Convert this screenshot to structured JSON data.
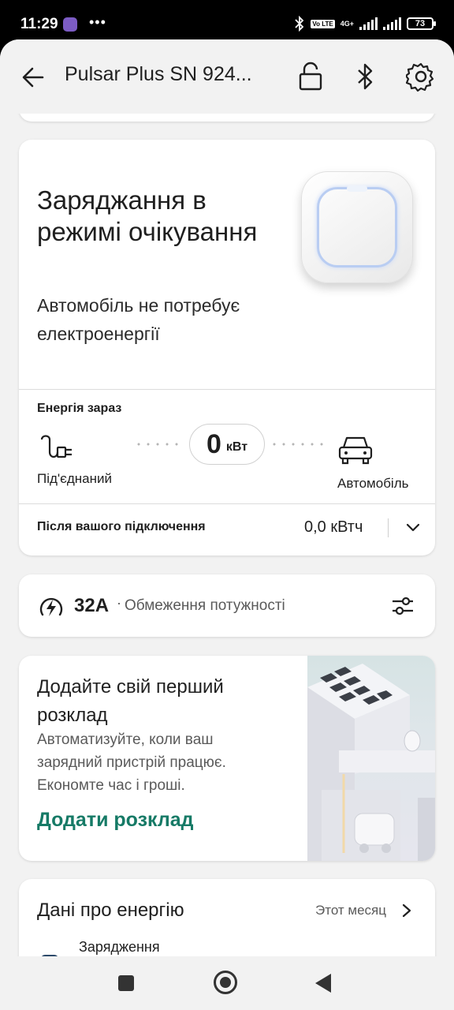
{
  "status_bar": {
    "time": "11:29",
    "dots": "•••",
    "network": "4G+",
    "volte": "Vo LTE",
    "battery": "73"
  },
  "app_bar": {
    "title": "Pulsar Plus SN 924..."
  },
  "status_card": {
    "title": "Заряджання в режимі очікування",
    "subtitle": "Автомобіль не потребує електроенергії",
    "energy_label": "Енергія зараз",
    "source_label": "Під'єднаний",
    "power_value": "0",
    "power_unit": "кВт",
    "target_label": "Автомобіль",
    "session_label": "Після вашого підключення",
    "session_value": "0,0 кВтч"
  },
  "limit_card": {
    "value": "32A",
    "separator": "·",
    "label": "Обмеження потужності"
  },
  "schedule_card": {
    "title": "Додайте свій перший розклад",
    "description": "Автоматизуйте, коли ваш зарядний пристрій працює. Економте час і гроші.",
    "link": "Додати розклад"
  },
  "energy_card": {
    "title": "Дані про енергію",
    "period": "Этот месяц",
    "series_label": "Зарядження"
  },
  "colors": {
    "accent": "#167a66",
    "background": "#f2f2f2",
    "card": "#ffffff"
  }
}
